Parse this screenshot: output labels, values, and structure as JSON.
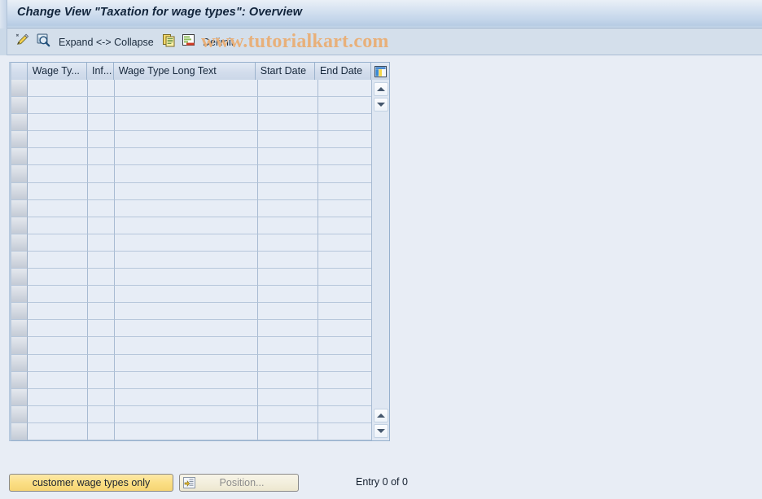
{
  "window": {
    "title": "Change View \"Taxation for wage types\": Overview"
  },
  "watermark": {
    "text": "www.tutorialkart.com",
    "color": "#e8b07a"
  },
  "toolbar": {
    "items": [
      {
        "name": "edit-pencil-icon",
        "label": "",
        "icon": "pencil-icon"
      },
      {
        "name": "display-magnifier-icon",
        "label": "",
        "icon": "magnifier-icon"
      },
      {
        "name": "expand-collapse-button",
        "label": "Expand <-> Collapse",
        "icon": ""
      },
      {
        "name": "copy-as-button",
        "label": "",
        "icon": "copy-icon"
      },
      {
        "name": "delimit-icon-button",
        "label": "",
        "icon": "delimit-icon"
      },
      {
        "name": "delimit-button",
        "label": "Delimit",
        "icon": ""
      }
    ],
    "expand_collapse_label": "Expand <-> Collapse",
    "delimit_label": "Delimit"
  },
  "table": {
    "columns": [
      {
        "key": "sel",
        "label": ""
      },
      {
        "key": "wage_type",
        "label": "Wage Ty..."
      },
      {
        "key": "infotype",
        "label": "Inf..."
      },
      {
        "key": "long_text",
        "label": "Wage Type Long Text"
      },
      {
        "key": "start_date",
        "label": "Start Date"
      },
      {
        "key": "end_date",
        "label": "End Date"
      }
    ],
    "config_icon": "table-settings-icon",
    "rows": [],
    "empty_row_count": 21
  },
  "scroll": {
    "top_up_icon": "scroll-up-icon",
    "top_down_icon": "scroll-down-icon",
    "bottom_up_icon": "scroll-up-icon",
    "bottom_down_icon": "scroll-down-icon"
  },
  "footer": {
    "customer_wage_types_button": "customer wage types only",
    "position_button": "Position...",
    "position_icon": "position-icon",
    "entry_count": "Entry 0 of 0"
  },
  "colors": {
    "background": "#e8edf5",
    "title_gradient_top": "#eaf0f7",
    "title_gradient_bottom": "#b7cce4",
    "toolbar_bg": "#d4dfeb",
    "table_bg": "#e7edf6",
    "header_bg": "#d3dded",
    "accent_yellow": "#fbdf86"
  }
}
